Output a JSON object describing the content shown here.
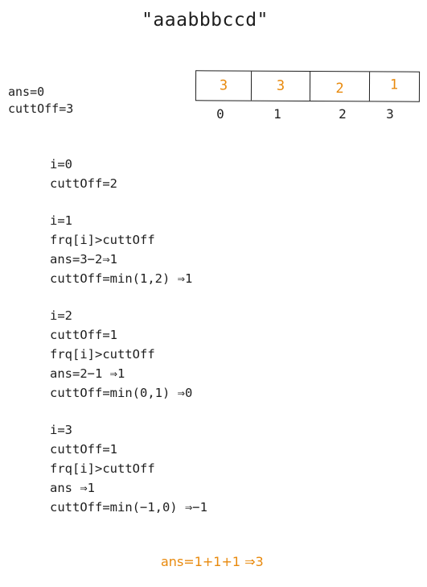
{
  "title": "\"aaabbbccd\"",
  "init": {
    "ans": "ans=0",
    "cutoff": "cuttOff=3"
  },
  "array": {
    "cells": [
      "3",
      "3",
      "2",
      "1"
    ],
    "indices": [
      "0",
      "1",
      "2",
      "3"
    ],
    "cell_color": "#e8890c"
  },
  "steps": [
    {
      "lines": [
        "i=0",
        "cuttOff=2"
      ]
    },
    {
      "lines": [
        "i=1",
        "frq[i]>cuttOff",
        "ans=3−2⇒1",
        "cuttOff=min(1,2) ⇒1"
      ]
    },
    {
      "lines": [
        "i=2",
        "cuttOff=1",
        "frq[i]>cuttOff",
        "ans=2−1 ⇒1",
        "cuttOff=min(0,1) ⇒0"
      ]
    },
    {
      "lines": [
        "i=3",
        "cuttOff=1",
        "frq[i]>cuttOff",
        "ans ⇒1",
        "cuttOff=min(−1,0) ⇒−1"
      ]
    }
  ],
  "result": "ans=1+1+1 ⇒3",
  "colors": {
    "accent": "#e8890c",
    "text": "#1e1e1e",
    "background": "#ffffff"
  }
}
